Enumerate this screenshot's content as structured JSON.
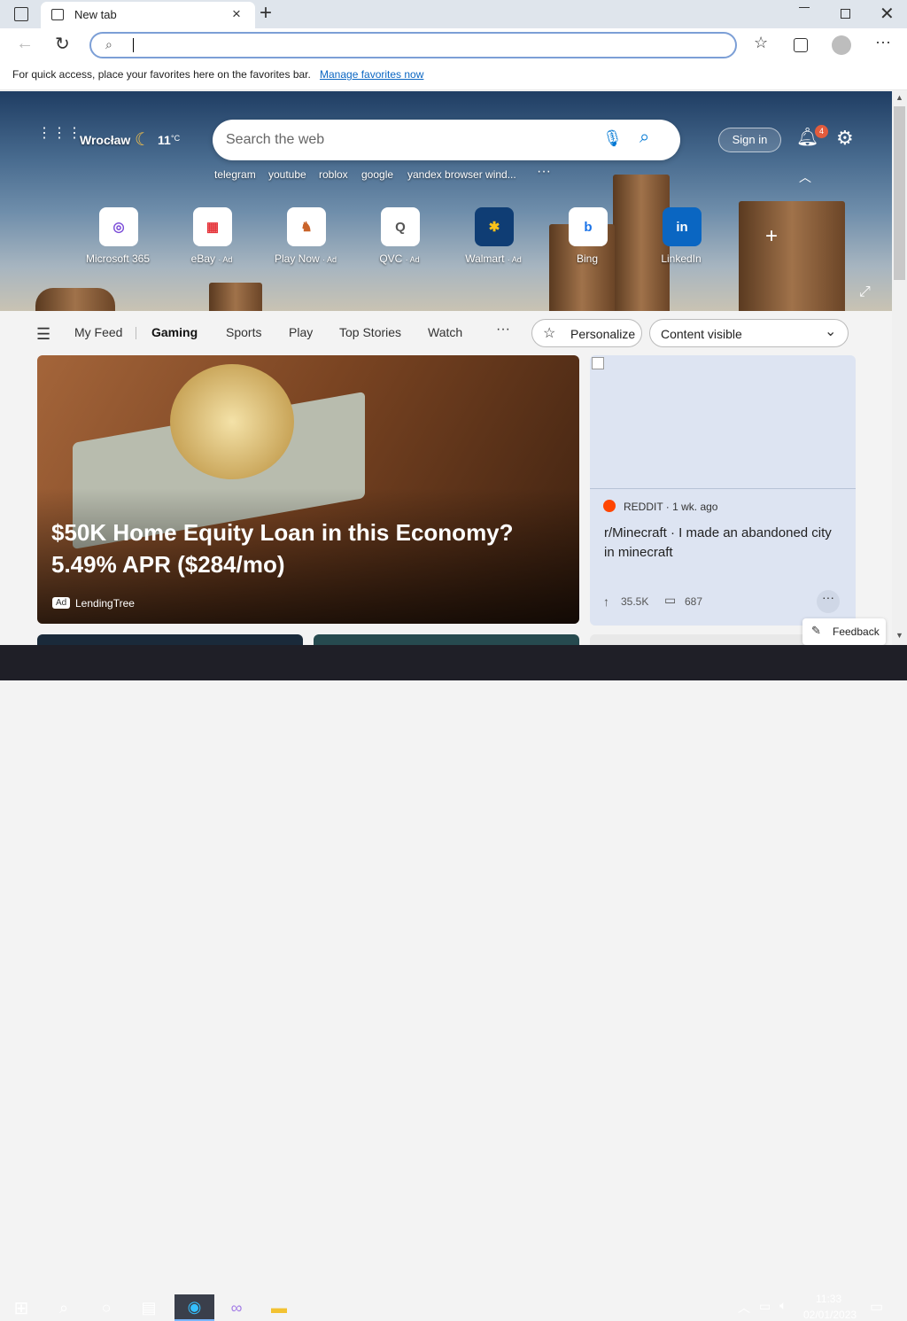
{
  "tab": {
    "title": "New tab"
  },
  "favbar": {
    "text": "For quick access, place your favorites here on the favorites bar.",
    "link": "Manage favorites now"
  },
  "weather": {
    "city": "Wrocław",
    "temp": "11",
    "unit": "°C"
  },
  "search": {
    "placeholder": "Search the web"
  },
  "quick_searches": [
    "telegram",
    "youtube",
    "roblox",
    "google",
    "yandex browser wind..."
  ],
  "account": {
    "sign_in": "Sign in",
    "notifications": "4"
  },
  "tiles": [
    {
      "label": "Microsoft 365",
      "ad": ""
    },
    {
      "label": "eBay",
      "ad": "· Ad"
    },
    {
      "label": "Play Now",
      "ad": "· Ad"
    },
    {
      "label": "QVC",
      "ad": "· Ad"
    },
    {
      "label": "Walmart",
      "ad": "· Ad"
    },
    {
      "label": "Bing",
      "ad": ""
    },
    {
      "label": "LinkedIn",
      "ad": ""
    }
  ],
  "feed_nav": {
    "items": [
      "My Feed",
      "Gaming",
      "Sports",
      "Play",
      "Top Stories",
      "Watch"
    ],
    "active": "Gaming",
    "personalize": "Personalize",
    "content": "Content visible"
  },
  "hero_card": {
    "title": "$50K Home Equity Loan in this Economy? 5.49% APR ($284/mo)",
    "ad": "Ad",
    "source": "LendingTree"
  },
  "reddit_card": {
    "source": "REDDIT · 1 wk. ago",
    "title": "r/Minecraft · I made an abandoned city in minecraft",
    "upvotes": "35.5K",
    "comments": "687"
  },
  "feedback": "Feedback",
  "clock": {
    "time": "11:33",
    "date": "02/01/2023"
  },
  "colors": {
    "accent": "#0078d4",
    "tabbar": "#dfe5ec"
  }
}
